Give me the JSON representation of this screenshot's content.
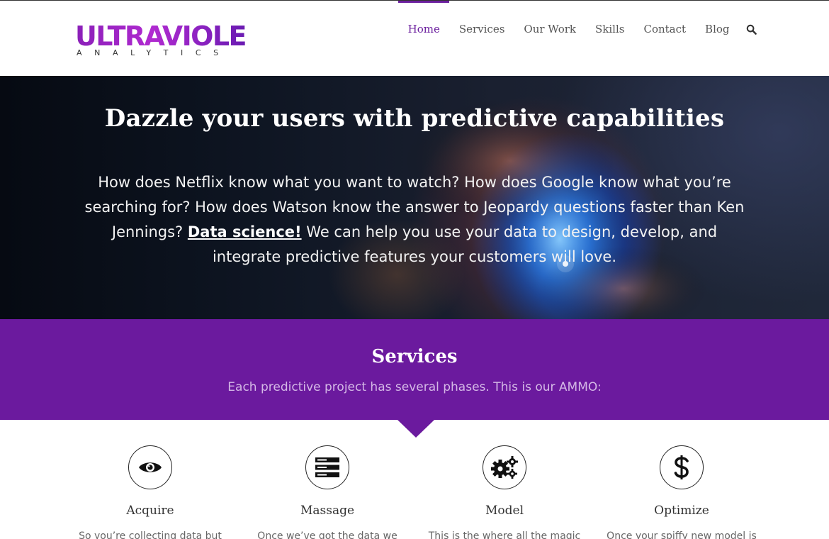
{
  "header": {
    "logo_main": "ULTRAVIOLET",
    "logo_sub": "ANALYTICS",
    "nav": [
      {
        "label": "Home",
        "active": true
      },
      {
        "label": "Services",
        "active": false
      },
      {
        "label": "Our Work",
        "active": false
      },
      {
        "label": "Skills",
        "active": false
      },
      {
        "label": "Contact",
        "active": false
      },
      {
        "label": "Blog",
        "active": false
      }
    ],
    "search_icon": "search-icon"
  },
  "hero": {
    "title": "Dazzle your users with predictive capabilities",
    "text_before": "How does Netflix know what you want to watch? How does Google know what you’re searching for? How does Watson know the answer to Jeopardy questions faster than Ken Jennings?",
    "link_label": "Data science!",
    "text_after": "We can help you use your data to design, develop, and integrate predictive features your customers will love."
  },
  "services": {
    "title": "Services",
    "subtitle": "Each predictive project has several phases. This is our AMMO:",
    "items": [
      {
        "title": "Acquire",
        "icon": "eye-icon",
        "text": "So you’re collecting data but"
      },
      {
        "title": "Massage",
        "icon": "server-icon",
        "text": "Once we’ve got the data we"
      },
      {
        "title": "Model",
        "icon": "gears-icon",
        "text": "This is the where all the magic"
      },
      {
        "title": "Optimize",
        "icon": "dollar-icon",
        "text": "Once your spiffy new model is"
      }
    ]
  },
  "colors": {
    "brand_purple": "#6b1a9e",
    "nav_active": "#6b1f9e",
    "subtitle_lavender": "#d4b8e6"
  }
}
